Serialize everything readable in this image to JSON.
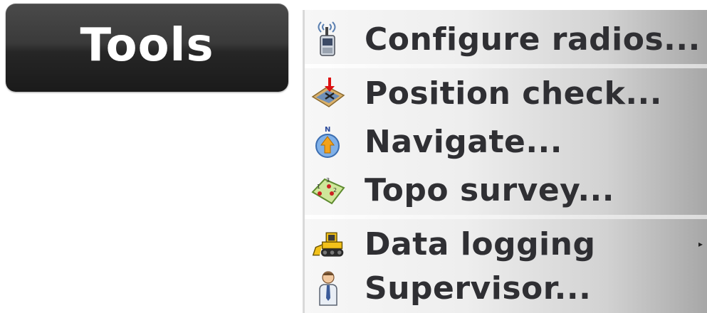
{
  "tools_button": {
    "label": "Tools"
  },
  "menu": {
    "items": [
      {
        "label": "Configure radios...",
        "icon": "radio-device-icon"
      },
      {
        "label": "Position check...",
        "icon": "position-check-icon"
      },
      {
        "label": "Navigate...",
        "icon": "compass-navigate-icon"
      },
      {
        "label": "Topo survey...",
        "icon": "topo-survey-icon"
      },
      {
        "label": "Data logging",
        "icon": "bulldozer-icon",
        "has_submenu": true,
        "submenu_indicator": "▸"
      },
      {
        "label": "Supervisor...",
        "icon": "supervisor-person-icon"
      }
    ]
  },
  "colors": {
    "button_dark": "#262626",
    "menu_text": "#2f2f33",
    "menu_light": "#f7f7f7",
    "menu_dark": "#a7a7a7"
  }
}
